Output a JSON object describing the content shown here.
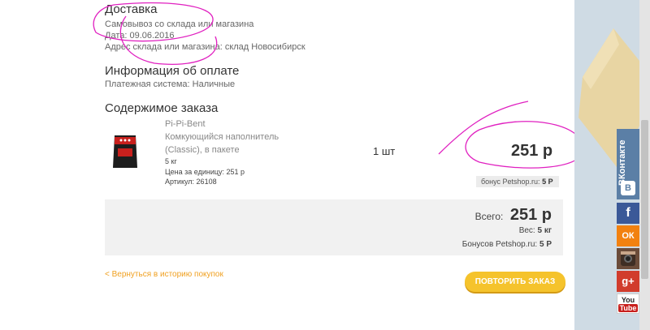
{
  "delivery": {
    "title": "Доставка",
    "method": "Самовывоз со склада или магазина",
    "date": "Дата: 09.06.2016",
    "address": "Адрес склада или магазина: склад Новосибирск"
  },
  "payment": {
    "title": "Информация об оплате",
    "system": "Платежная система: Наличные"
  },
  "order": {
    "title": "Содержимое заказа",
    "item": {
      "name_line1": "Pi-Pi-Bent",
      "name_line2": "Комкующийся наполнитель",
      "name_line3": "(Classic), в пакете",
      "weight": "5 кг",
      "unit_price": "Цена за единицу: 251 р",
      "article": "Артикул: 26108",
      "qty": "1 шт",
      "price": "251 р",
      "bonus_label": "бонус Petshop.ru:",
      "bonus_value": "5 Р"
    }
  },
  "totals": {
    "total_label": "Всего:",
    "total_value": "251 р",
    "weight_label": "Вес:",
    "weight_value": "5 кг",
    "bonus_label": "Бонусов Petshop.ru:",
    "bonus_value": "5 Р"
  },
  "actions": {
    "back": "< Вернуться в историю покупок",
    "repeat": "ПОВТОРИТЬ ЗАКАЗ"
  },
  "social": {
    "vk": "ВКонтакте",
    "fb": "f",
    "ok": "ОК",
    "g": "g+",
    "yt_1": "You",
    "yt_2": "Tube"
  },
  "colors": {
    "accent": "#f5c32c",
    "link": "#f0a020",
    "annotation": "#e020c0",
    "vk": "#5b7fa6",
    "fb": "#3b5998",
    "ok": "#f2810f",
    "gplus": "#d13c2c",
    "youtube": "#c8201d"
  }
}
